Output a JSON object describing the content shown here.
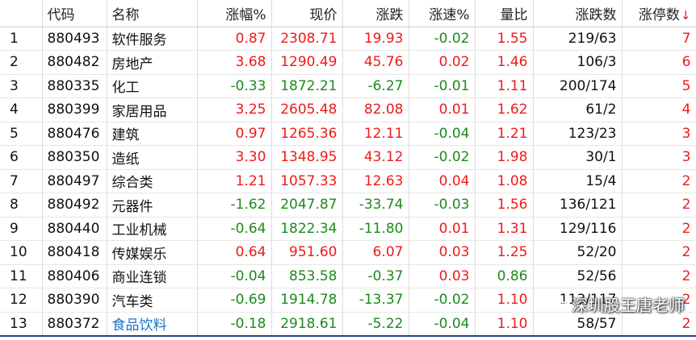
{
  "table": {
    "headers": {
      "idx": "",
      "code": "代码",
      "name": "名称",
      "change_pct": "涨幅%",
      "price": "现价",
      "change": "涨跌",
      "speed": "涨速%",
      "vol_ratio": "量比",
      "up_down_count": "涨跌数",
      "limit_up_count": "涨停数"
    },
    "sort_indicator": "↓",
    "rows": [
      {
        "idx": "1",
        "code": "880493",
        "name": "软件服务",
        "change_pct": "0.87",
        "price": "2308.71",
        "change": "19.93",
        "speed": "-0.02",
        "vol_ratio": "1.55",
        "up_down": "219/63",
        "limit_up": "7"
      },
      {
        "idx": "2",
        "code": "880482",
        "name": "房地产",
        "change_pct": "3.68",
        "price": "1290.49",
        "change": "45.76",
        "speed": "0.02",
        "vol_ratio": "1.46",
        "up_down": "106/3",
        "limit_up": "6"
      },
      {
        "idx": "3",
        "code": "880335",
        "name": "化工",
        "change_pct": "-0.33",
        "price": "1872.21",
        "change": "-6.27",
        "speed": "-0.01",
        "vol_ratio": "1.11",
        "up_down": "200/174",
        "limit_up": "5"
      },
      {
        "idx": "4",
        "code": "880399",
        "name": "家居用品",
        "change_pct": "3.25",
        "price": "2605.48",
        "change": "82.08",
        "speed": "0.01",
        "vol_ratio": "1.62",
        "up_down": "61/2",
        "limit_up": "4"
      },
      {
        "idx": "5",
        "code": "880476",
        "name": "建筑",
        "change_pct": "0.97",
        "price": "1265.36",
        "change": "12.11",
        "speed": "-0.04",
        "vol_ratio": "1.21",
        "up_down": "123/23",
        "limit_up": "3"
      },
      {
        "idx": "6",
        "code": "880350",
        "name": "造纸",
        "change_pct": "3.30",
        "price": "1348.95",
        "change": "43.12",
        "speed": "-0.02",
        "vol_ratio": "1.98",
        "up_down": "30/1",
        "limit_up": "3"
      },
      {
        "idx": "7",
        "code": "880497",
        "name": "综合类",
        "change_pct": "1.21",
        "price": "1057.33",
        "change": "12.63",
        "speed": "0.04",
        "vol_ratio": "1.08",
        "up_down": "15/4",
        "limit_up": "2"
      },
      {
        "idx": "8",
        "code": "880492",
        "name": "元器件",
        "change_pct": "-1.62",
        "price": "2047.87",
        "change": "-33.74",
        "speed": "-0.03",
        "vol_ratio": "1.56",
        "up_down": "136/121",
        "limit_up": "2"
      },
      {
        "idx": "9",
        "code": "880440",
        "name": "工业机械",
        "change_pct": "-0.64",
        "price": "1822.34",
        "change": "-11.80",
        "speed": "0.01",
        "vol_ratio": "1.31",
        "up_down": "129/116",
        "limit_up": "2"
      },
      {
        "idx": "10",
        "code": "880418",
        "name": "传媒娱乐",
        "change_pct": "0.64",
        "price": "951.60",
        "change": "6.07",
        "speed": "0.03",
        "vol_ratio": "1.25",
        "up_down": "52/20",
        "limit_up": "2"
      },
      {
        "idx": "11",
        "code": "880406",
        "name": "商业连锁",
        "change_pct": "-0.04",
        "price": "853.58",
        "change": "-0.37",
        "speed": "0.03",
        "vol_ratio": "0.86",
        "up_down": "52/56",
        "limit_up": "2"
      },
      {
        "idx": "12",
        "code": "880390",
        "name": "汽车类",
        "change_pct": "-0.69",
        "price": "1914.78",
        "change": "-13.37",
        "speed": "-0.02",
        "vol_ratio": "1.10",
        "up_down": "113/117",
        "limit_up": "2"
      },
      {
        "idx": "13",
        "code": "880372",
        "name": "食品饮料",
        "change_pct": "-0.18",
        "price": "2918.61",
        "change": "-5.22",
        "speed": "-0.04",
        "vol_ratio": "1.10",
        "up_down": "58/57",
        "limit_up": "2"
      }
    ],
    "selected_row": 12
  },
  "watermark": {
    "text": "深圳股王唐老师",
    "icon": "wechat-icon"
  },
  "colors": {
    "up": "#ee1a1a",
    "down": "#1d8a1d",
    "selected_name": "#1a73c7",
    "bottom_border": "#2c3e94"
  }
}
